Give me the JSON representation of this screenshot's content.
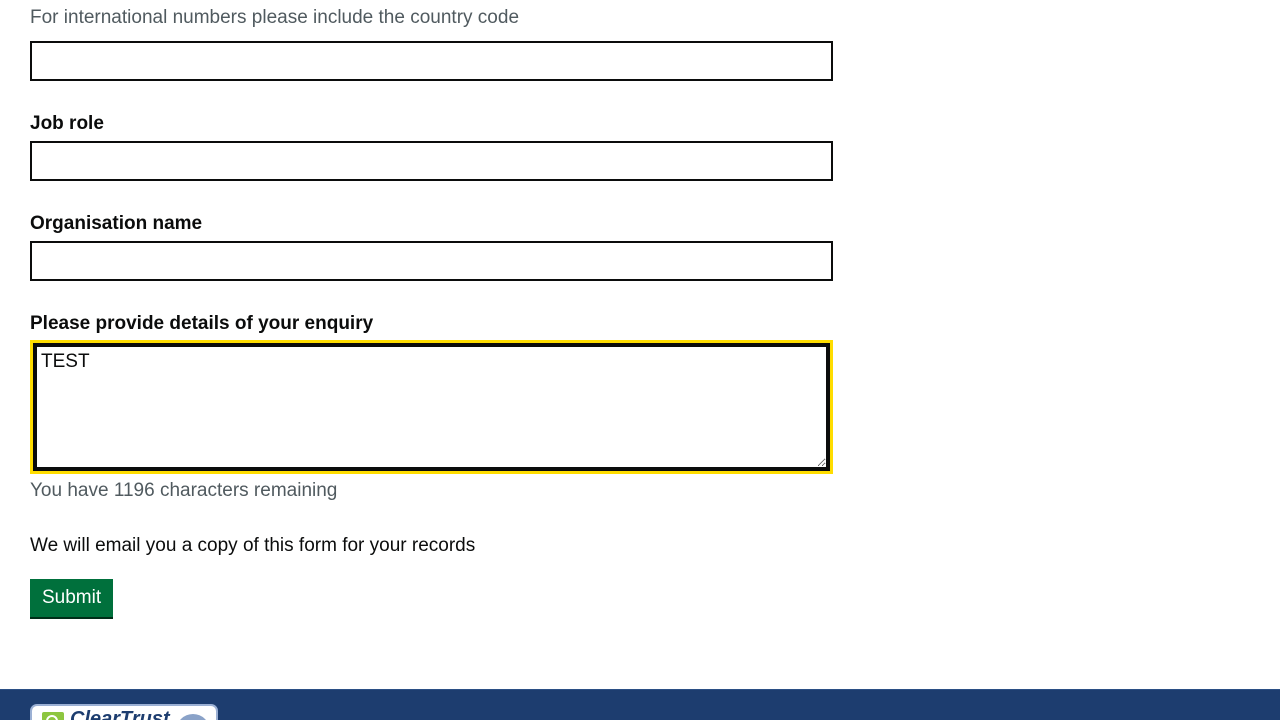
{
  "form": {
    "phone_hint": "For international numbers please include the country code",
    "phone_value": "",
    "job_role_label": "Job role",
    "job_role_value": "",
    "organisation_label": "Organisation name",
    "organisation_value": "",
    "enquiry_label": "Please provide details of your enquiry",
    "enquiry_value": "TEST",
    "characters_remaining": "You have 1196 characters remaining",
    "email_note": "We will email you a copy of this form for your records",
    "submit_label": "Submit"
  },
  "footer": {
    "badge_text": "ClearTrust",
    "background_color": "#1d3d6f"
  },
  "colors": {
    "focus": "#ffdd00",
    "submit": "#00703c",
    "hint": "#505a5f"
  }
}
